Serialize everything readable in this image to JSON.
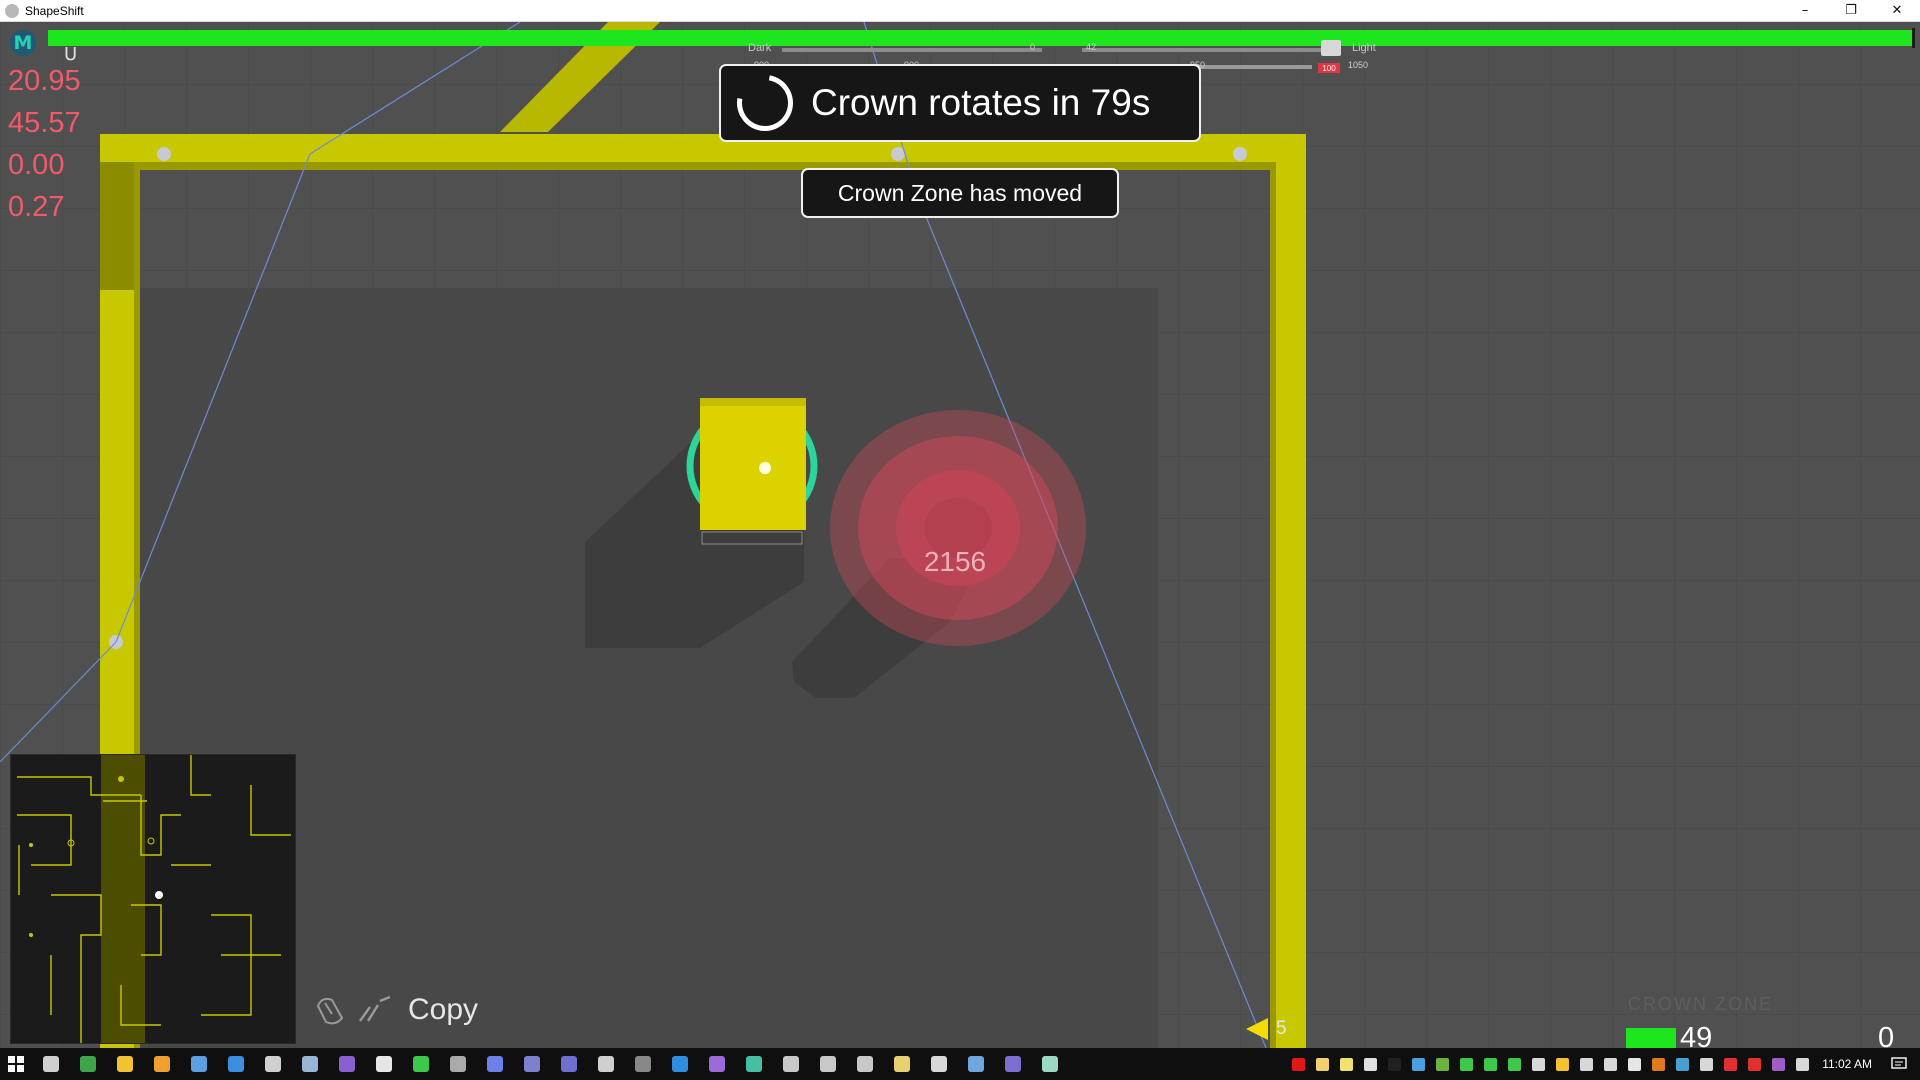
{
  "window": {
    "title": "ShapeShift",
    "minimize": "–",
    "restore": "❐",
    "close": "✕"
  },
  "hud": {
    "logo_letter": "M",
    "cup_glyph": "U",
    "stats": [
      "20.95",
      "45.57",
      "0.00",
      "0.27"
    ],
    "hp_fraction": 1.0,
    "slider": {
      "dark_label": "Dark",
      "light_label": "Light",
      "top_values": [
        "0",
        "42"
      ],
      "bottom_values": [
        "900",
        "900",
        "950",
        "1050"
      ],
      "warning_value": "100"
    },
    "crown_timer": "Crown rotates in 79s",
    "crown_moved": "Crown Zone has moved",
    "enemy_label": "2156",
    "copy_label": "Copy",
    "ammo_count": "5",
    "zone_watermark": "CROWN ZONE",
    "health_value": "49",
    "score_value": "0"
  },
  "colors": {
    "wall": "#c8c800",
    "hp": "#1ee61e",
    "stat_text": "#f15a6a",
    "enemy": "#e04a5a",
    "player": "#dcd200",
    "player_ring": "#2bd59b"
  },
  "taskbar": {
    "clock": "11:02 AM",
    "app_icons": [
      {
        "name": "task-view-icon",
        "color": "#cfcfcf"
      },
      {
        "name": "chrome-icon",
        "color": "#3fa54a"
      },
      {
        "name": "file-explorer-icon",
        "color": "#f2c230"
      },
      {
        "name": "media-player-icon",
        "color": "#f0a030"
      },
      {
        "name": "notes-icon",
        "color": "#5aa0e0"
      },
      {
        "name": "editor-icon",
        "color": "#3b8ee0"
      },
      {
        "name": "unity-hub-icon",
        "color": "#d0d0d0"
      },
      {
        "name": "steam-icon",
        "color": "#9bb5d6"
      },
      {
        "name": "visual-studio-icon",
        "color": "#8a5fd1"
      },
      {
        "name": "visual-studio-code-icon",
        "color": "#e6e6e6"
      },
      {
        "name": "h-app-icon",
        "color": "#3cc84a"
      },
      {
        "name": "terminal-icon",
        "color": "#aaaaaa"
      },
      {
        "name": "discord-icon",
        "color": "#6d7fe8"
      },
      {
        "name": "eclipse-icon",
        "color": "#7f7fcf"
      },
      {
        "name": "eclipse-2-icon",
        "color": "#6f6fd0"
      },
      {
        "name": "unity-icon",
        "color": "#cfcfcf"
      },
      {
        "name": "photoshop-icon",
        "color": "#888888"
      },
      {
        "name": "vscode-icon",
        "color": "#2e8fe0"
      },
      {
        "name": "vpn-icon",
        "color": "#9c6bd9"
      },
      {
        "name": "vs-2-icon",
        "color": "#46c0a0"
      },
      {
        "name": "git-icon",
        "color": "#c8c8c8"
      },
      {
        "name": "settings-app-icon",
        "color": "#c8c8c8"
      },
      {
        "name": "display-icon",
        "color": "#c8c8c8"
      },
      {
        "name": "sticky-notes-icon",
        "color": "#e8d070"
      },
      {
        "name": "obs-icon",
        "color": "#d8d8d8"
      },
      {
        "name": "snip-icon",
        "color": "#6fa8e0"
      },
      {
        "name": "game-icon",
        "color": "#7a6fd0"
      },
      {
        "name": "shapeshift-icon",
        "color": "#9bd9c5"
      }
    ],
    "tray_icons": [
      {
        "name": "red-square-icon",
        "color": "#e01818"
      },
      {
        "name": "folder-tray-icon",
        "color": "#f2d070"
      },
      {
        "name": "note-tray-icon",
        "color": "#f2e070"
      },
      {
        "name": "stack-tray-icon",
        "color": "#e0e0e0"
      },
      {
        "name": "black-tray-icon",
        "color": "#202020"
      },
      {
        "name": "bars-tray-icon",
        "color": "#4aa0e0"
      },
      {
        "name": "nvidia-tray-icon",
        "color": "#6cb33e"
      },
      {
        "name": "h-tray-icon-1",
        "color": "#3cc84a"
      },
      {
        "name": "h-tray-icon-2",
        "color": "#3cc84a"
      },
      {
        "name": "h-tray-icon-3",
        "color": "#3cc84a"
      },
      {
        "name": "shield-tray-icon",
        "color": "#d8d8d8"
      },
      {
        "name": "star-tray-icon",
        "color": "#f2c230"
      },
      {
        "name": "gear-tray-icon",
        "color": "#d8d8d8"
      },
      {
        "name": "phone-tray-icon",
        "color": "#d8d8d8"
      },
      {
        "name": "vs-tray-icon",
        "color": "#e6e6e6"
      },
      {
        "name": "orange-tray-icon",
        "color": "#e07a20"
      },
      {
        "name": "network-tray-icon",
        "color": "#48a0d0"
      },
      {
        "name": "volume-icon",
        "color": "#d8d8d8"
      },
      {
        "name": "red-tray-icon",
        "color": "#e03030"
      },
      {
        "name": "acrobat-tray-icon",
        "color": "#e03030"
      },
      {
        "name": "onenote-tray-icon",
        "color": "#a05cc8"
      },
      {
        "name": "monitor-tray-icon",
        "color": "#d8d8d8"
      }
    ]
  }
}
